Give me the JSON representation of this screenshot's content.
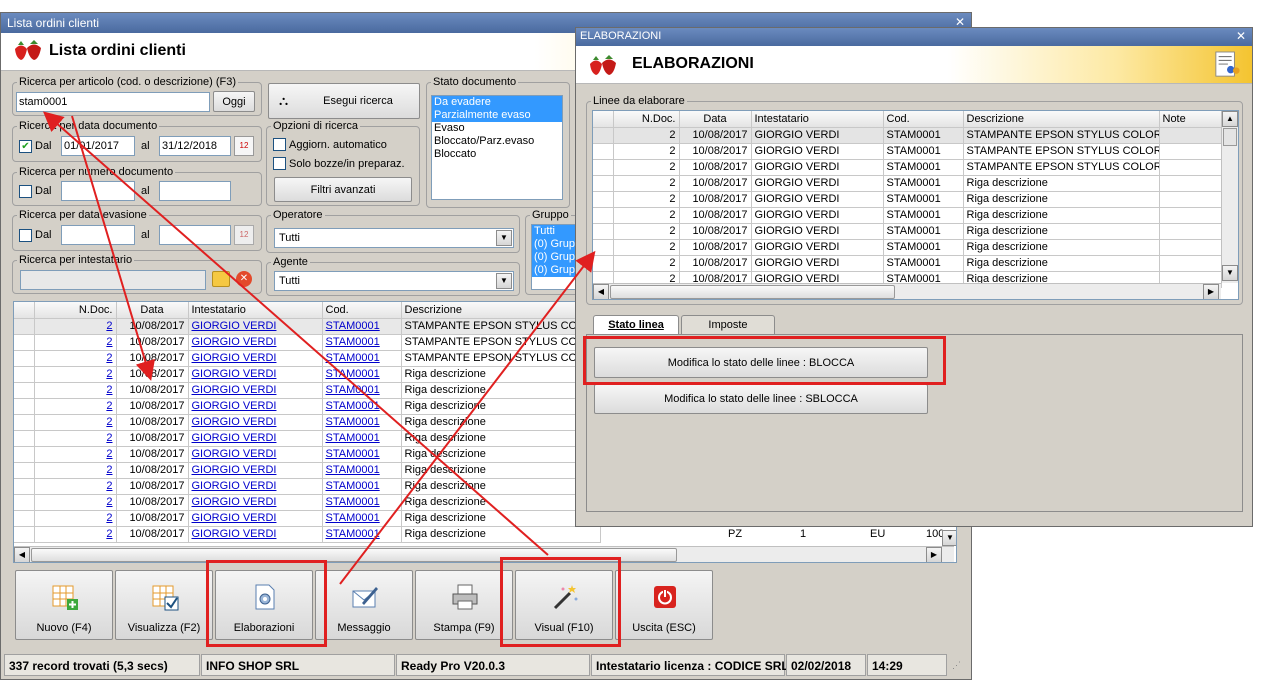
{
  "main": {
    "window_title": "Lista ordini clienti",
    "header_title": "Lista ordini clienti",
    "search_article": {
      "legend": "Ricerca per articolo (cod. o descrizione) (F3)",
      "value": "stam0001",
      "today_button": "Oggi"
    },
    "search_button": "Esegui ricerca",
    "doc_date": {
      "legend": "Ricerca per data documento",
      "from_label": "Dal",
      "from": "01/01/2017",
      "to_label": "al",
      "to": "31/12/2018"
    },
    "doc_number": {
      "legend": "Ricerca per numero documento",
      "from_label": "Dal",
      "to_label": "al"
    },
    "eva_date": {
      "legend": "Ricerca per data evasione",
      "from_label": "Dal",
      "to_label": "al"
    },
    "holder": {
      "legend": "Ricerca per intestatario"
    },
    "options": {
      "legend": "Opzioni di ricerca",
      "auto": "Aggiorn. automatico",
      "drafts": "Solo bozze/in preparaz.",
      "advanced": "Filtri avanzati"
    },
    "status": {
      "legend": "Stato documento",
      "items": [
        "Da evadere",
        "Parzialmente evaso",
        "Evaso",
        "Bloccato/Parz.evaso",
        "Bloccato"
      ]
    },
    "operator": {
      "legend": "Operatore",
      "value": "Tutti"
    },
    "agent": {
      "legend": "Agente",
      "value": "Tutti"
    },
    "group": {
      "legend": "Gruppo",
      "items": [
        "Tutti",
        "(0) Grup",
        "(0) Grup",
        "(0) Grup"
      ]
    },
    "table": {
      "columns": [
        "N.Doc.",
        "Data",
        "Intestatario",
        "Cod.",
        "Descrizione"
      ],
      "rows": [
        [
          "2",
          "10/08/2017",
          "GIORGIO VERDI",
          "STAM0001",
          "STAMPANTE EPSON STYLUS COLOR C..."
        ],
        [
          "2",
          "10/08/2017",
          "GIORGIO VERDI",
          "STAM0001",
          "STAMPANTE EPSON STYLUS COLOR C..."
        ],
        [
          "2",
          "10/08/2017",
          "GIORGIO VERDI",
          "STAM0001",
          "STAMPANTE EPSON STYLUS COLOR C..."
        ],
        [
          "2",
          "10/08/2017",
          "GIORGIO VERDI",
          "STAM0001",
          "Riga descrizione"
        ],
        [
          "2",
          "10/08/2017",
          "GIORGIO VERDI",
          "STAM0001",
          "Riga descrizione"
        ],
        [
          "2",
          "10/08/2017",
          "GIORGIO VERDI",
          "STAM0001",
          "Riga descrizione"
        ],
        [
          "2",
          "10/08/2017",
          "GIORGIO VERDI",
          "STAM0001",
          "Riga descrizione"
        ],
        [
          "2",
          "10/08/2017",
          "GIORGIO VERDI",
          "STAM0001",
          "Riga descrizione"
        ],
        [
          "2",
          "10/08/2017",
          "GIORGIO VERDI",
          "STAM0001",
          "Riga descrizione"
        ],
        [
          "2",
          "10/08/2017",
          "GIORGIO VERDI",
          "STAM0001",
          "Riga descrizione"
        ],
        [
          "2",
          "10/08/2017",
          "GIORGIO VERDI",
          "STAM0001",
          "Riga descrizione"
        ],
        [
          "2",
          "10/08/2017",
          "GIORGIO VERDI",
          "STAM0001",
          "Riga descrizione"
        ],
        [
          "2",
          "10/08/2017",
          "GIORGIO VERDI",
          "STAM0001",
          "Riga descrizione"
        ],
        [
          "2",
          "10/08/2017",
          "GIORGIO VERDI",
          "STAM0001",
          "Riga descrizione"
        ]
      ],
      "extra_row_visible": [
        "PZ",
        "1",
        "EU",
        "100,"
      ]
    },
    "toolbar": [
      "Nuovo (F4)",
      "Visualizza (F2)",
      "Elaborazioni",
      "Messaggio",
      "Stampa (F9)",
      "Visual (F10)",
      "Uscita (ESC)"
    ],
    "statusbar": [
      "337 record trovati (5,3 secs)",
      "INFO SHOP SRL",
      "Ready Pro V20.0.3",
      "Intestatario licenza : CODICE SRL",
      "02/02/2018",
      "14:29"
    ]
  },
  "dialog": {
    "window_title": "ELABORAZIONI",
    "header_title": "ELABORAZIONI",
    "lines_legend": "Linee da elaborare",
    "columns": [
      "N.Doc.",
      "Data",
      "Intestatario",
      "Cod.",
      "Descrizione",
      "Note"
    ],
    "rows": [
      [
        "2",
        "10/08/2017",
        "GIORGIO VERDI",
        "STAM0001",
        "STAMPANTE EPSON STYLUS COLOR C..."
      ],
      [
        "2",
        "10/08/2017",
        "GIORGIO VERDI",
        "STAM0001",
        "STAMPANTE EPSON STYLUS COLOR C..."
      ],
      [
        "2",
        "10/08/2017",
        "GIORGIO VERDI",
        "STAM0001",
        "STAMPANTE EPSON STYLUS COLOR C..."
      ],
      [
        "2",
        "10/08/2017",
        "GIORGIO VERDI",
        "STAM0001",
        "Riga descrizione"
      ],
      [
        "2",
        "10/08/2017",
        "GIORGIO VERDI",
        "STAM0001",
        "Riga descrizione"
      ],
      [
        "2",
        "10/08/2017",
        "GIORGIO VERDI",
        "STAM0001",
        "Riga descrizione"
      ],
      [
        "2",
        "10/08/2017",
        "GIORGIO VERDI",
        "STAM0001",
        "Riga descrizione"
      ],
      [
        "2",
        "10/08/2017",
        "GIORGIO VERDI",
        "STAM0001",
        "Riga descrizione"
      ],
      [
        "2",
        "10/08/2017",
        "GIORGIO VERDI",
        "STAM0001",
        "Riga descrizione"
      ],
      [
        "2",
        "10/08/2017",
        "GIORGIO VERDI",
        "STAM0001",
        "Riga descrizione"
      ]
    ],
    "tabs": [
      "Stato linea",
      "Imposte"
    ],
    "block_button": "Modifica lo stato delle linee : BLOCCA",
    "unblock_button": "Modifica lo stato delle linee : SBLOCCA"
  },
  "colors": {
    "highlight": "#e02020",
    "selection": "#3399ff",
    "link": "#0000cc"
  }
}
